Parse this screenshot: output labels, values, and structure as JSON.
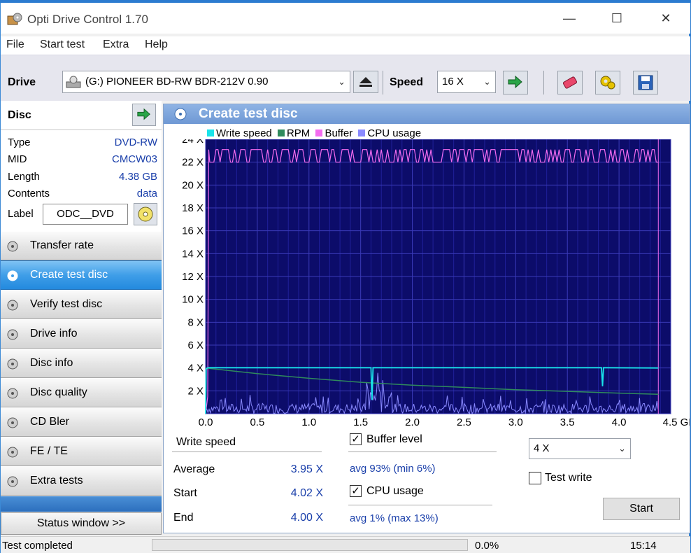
{
  "window": {
    "title": "Opti Drive Control 1.70",
    "minimize": "—",
    "maximize": "☐",
    "close": "✕"
  },
  "menu": [
    "File",
    "Start test",
    "Extra",
    "Help"
  ],
  "toolbar": {
    "drive_label": "Drive",
    "drive_value": "(G:)  PIONEER BD-RW   BDR-212V 0.90",
    "speed_label": "Speed",
    "speed_value": "16 X"
  },
  "disc": {
    "header": "Disc",
    "rows": [
      {
        "key": "Type",
        "value": "DVD-RW"
      },
      {
        "key": "MID",
        "value": "CMCW03"
      },
      {
        "key": "Length",
        "value": "4.38 GB"
      },
      {
        "key": "Contents",
        "value": "data"
      }
    ],
    "label_key": "Label",
    "label_value": "ODC__DVD"
  },
  "nav": [
    {
      "name": "transfer-rate",
      "label": "Transfer rate",
      "active": false
    },
    {
      "name": "create-test-disc",
      "label": "Create test disc",
      "active": true
    },
    {
      "name": "verify-test-disc",
      "label": "Verify test disc",
      "active": false
    },
    {
      "name": "drive-info",
      "label": "Drive info",
      "active": false
    },
    {
      "name": "disc-info",
      "label": "Disc info",
      "active": false
    },
    {
      "name": "disc-quality",
      "label": "Disc quality",
      "active": false
    },
    {
      "name": "cd-bler",
      "label": "CD Bler",
      "active": false
    },
    {
      "name": "fe-te",
      "label": "FE / TE",
      "active": false
    },
    {
      "name": "extra-tests",
      "label": "Extra tests",
      "active": false
    }
  ],
  "status_window_label": "Status window >>",
  "panel": {
    "title": "Create test disc"
  },
  "chart_data": {
    "type": "line",
    "title": "",
    "x_unit": "GB",
    "xlim": [
      0,
      4.5
    ],
    "ylim": [
      0,
      24
    ],
    "x_ticks": [
      "0.0",
      "0.5",
      "1.0",
      "1.5",
      "2.0",
      "2.5",
      "3.0",
      "3.5",
      "4.0",
      "4.5 GB"
    ],
    "y_ticks": [
      "2 X",
      "4 X",
      "6 X",
      "8 X",
      "10 X",
      "12 X",
      "14 X",
      "16 X",
      "18 X",
      "20 X",
      "22 X",
      "24 X"
    ],
    "grid": true,
    "legend": [
      {
        "name": "Write speed",
        "color": "#19e3ea"
      },
      {
        "name": "RPM",
        "color": "#2f8a5c"
      },
      {
        "name": "Buffer",
        "color": "#f46cf0"
      },
      {
        "name": "CPU usage",
        "color": "#8a8aff"
      }
    ],
    "series": [
      {
        "name": "Write speed",
        "color": "#19e3ea",
        "x": [
          0.0,
          0.005,
          0.02,
          1.6,
          1.61,
          1.62,
          1.63,
          3.83,
          3.84,
          3.85,
          3.86,
          4.38
        ],
        "y": [
          0,
          3.9,
          4.02,
          4.02,
          1.2,
          4.02,
          4.02,
          4.02,
          2.4,
          4.02,
          4.02,
          4.0
        ]
      },
      {
        "name": "RPM",
        "color": "#2f8a5c",
        "x": [
          0.0,
          0.5,
          1.0,
          1.5,
          2.0,
          2.5,
          3.0,
          3.5,
          4.0,
          4.38
        ],
        "y": [
          4.0,
          3.5,
          3.1,
          2.75,
          2.5,
          2.3,
          2.1,
          1.95,
          1.8,
          1.7
        ]
      },
      {
        "name": "Buffer",
        "color": "#f46cf0",
        "min_percent": 6,
        "avg_percent": 93
      },
      {
        "name": "CPU usage",
        "color": "#8a8aff",
        "avg_percent": 1,
        "max_percent": 13
      }
    ]
  },
  "stats": {
    "write_speed_header": "Write speed",
    "average_label": "Average",
    "average_value": "3.95 X",
    "start_label": "Start",
    "start_value": "4.02 X",
    "end_label": "End",
    "end_value": "4.00 X",
    "buffer_level_label": "Buffer level",
    "buffer_level_text": "avg 93% (min 6%)",
    "cpu_usage_label": "CPU usage",
    "cpu_usage_text": "avg 1% (max 13%)",
    "write_speed_select": "4 X",
    "test_write_label": "Test write",
    "start_button": "Start"
  },
  "statusbar": {
    "text": "Test completed",
    "progress": "0.0%",
    "progress_fraction": 0,
    "time": "15:14"
  }
}
